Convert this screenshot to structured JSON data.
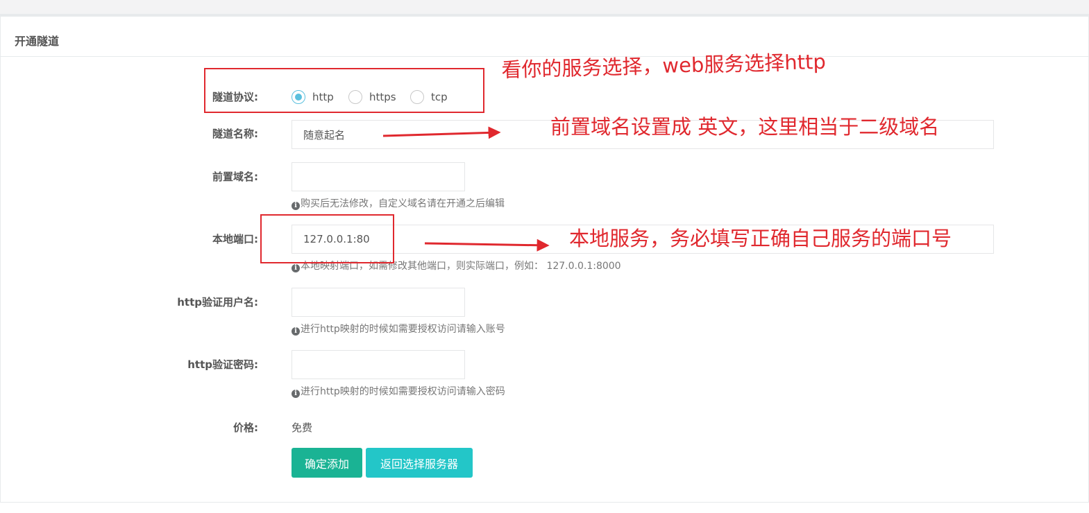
{
  "panel": {
    "title": "开通隧道"
  },
  "form": {
    "protocol": {
      "label": "隧道协议:",
      "options": [
        "http",
        "https",
        "tcp"
      ],
      "selected": "http"
    },
    "tunnel_name": {
      "label": "隧道名称:",
      "value": "随意起名"
    },
    "prefix_domain": {
      "label": "前置域名:",
      "value": "",
      "help": "购买后无法修改，自定义域名请在开通之后编辑"
    },
    "local_port": {
      "label": "本地端口:",
      "value": "127.0.0.1:80",
      "help": "本地映射端口，如需修改其他端口，则实际端口，例如： 127.0.0.1:8000"
    },
    "http_user": {
      "label": "http验证用户名:",
      "value": "",
      "help": "进行http映射的时候如需要授权访问请输入账号"
    },
    "http_password": {
      "label": "http验证密码:",
      "value": "",
      "help": "进行http映射的时候如需要授权访问请输入密码"
    },
    "price": {
      "label": "价格:",
      "value": "免费"
    },
    "buttons": {
      "confirm": "确定添加",
      "back": "返回选择服务器"
    }
  },
  "annotations": {
    "protocol_note": "看你的服务选择，web服务选择http",
    "domain_note": "前置域名设置成 英文，这里相当于二级域名",
    "port_note": "本地服务，务必填写正确自己服务的端口号",
    "color": "#e0282e"
  },
  "colors": {
    "primary": "#1ab394",
    "info": "#23c6c8",
    "radio_checked": "#5bc0de"
  }
}
